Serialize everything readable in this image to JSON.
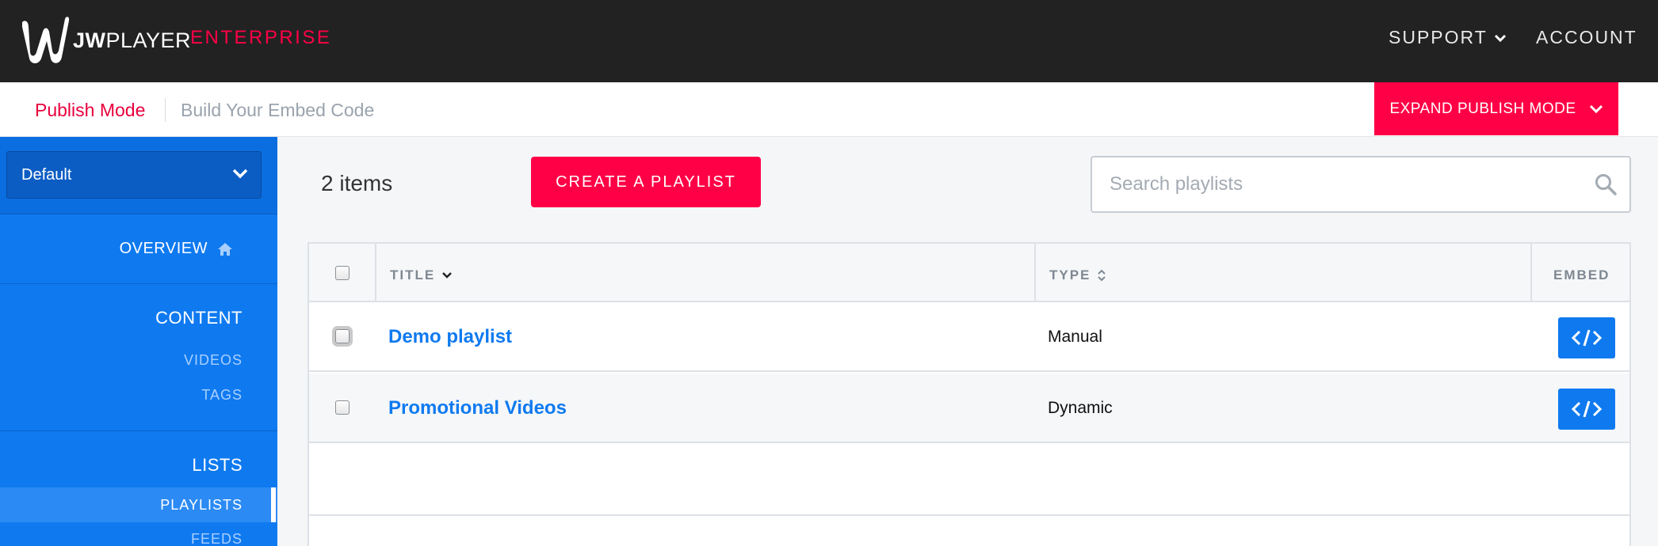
{
  "header": {
    "logo_bold": "JW",
    "logo_light": "PLAYER",
    "logo_sub": "ENTERPRISE",
    "nav": {
      "support": "SUPPORT",
      "account": "ACCOUNT"
    }
  },
  "subheader": {
    "publish_mode": "Publish Mode",
    "build_embed": "Build Your Embed Code",
    "expand_label": "EXPAND PUBLISH MODE"
  },
  "sidebar": {
    "property_select": "Default",
    "overview": "OVERVIEW",
    "content_head": "CONTENT",
    "content_items": [
      "VIDEOS",
      "TAGS"
    ],
    "lists_head": "LISTS",
    "lists_items": [
      "PLAYLISTS",
      "FEEDS"
    ]
  },
  "main": {
    "items_count": "2 items",
    "create_label": "CREATE A PLAYLIST",
    "search_placeholder": "Search playlists",
    "columns": {
      "title": "TITLE",
      "type": "TYPE",
      "embed": "EMBED"
    },
    "rows": [
      {
        "title": "Demo playlist",
        "type": "Manual"
      },
      {
        "title": "Promotional Videos",
        "type": "Dynamic"
      }
    ]
  },
  "colors": {
    "brand": "#ff0046",
    "accent": "#0f7af0",
    "nav_bg": "#222222"
  },
  "icons": [
    "jw-logo-icon",
    "chevron-down-icon",
    "home-icon",
    "search-icon",
    "sort-icon",
    "embed-code-icon"
  ]
}
